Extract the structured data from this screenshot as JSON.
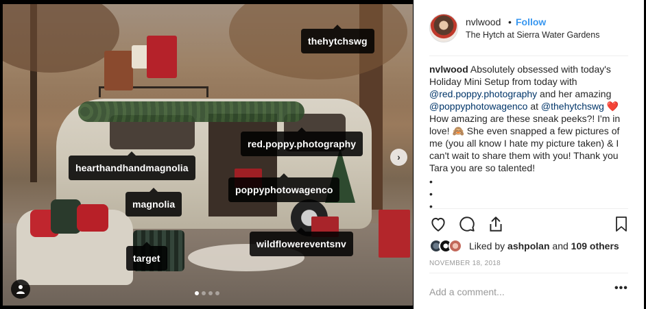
{
  "post": {
    "username": "nvlwood",
    "separator": "•",
    "follow_label": "Follow",
    "location": "The Hytch at Sierra Water Gardens",
    "caption": {
      "user": "nvlwood",
      "text_1": " Absolutely obsessed with today's Holiday Mini Setup from today with ",
      "mention_1": "@red.poppy.photography",
      "text_2": " and her amazing ",
      "mention_2": "@poppyphotowagenco",
      "text_3": " at ",
      "mention_3": "@thehytchswg",
      "heart": " ❤️",
      "text_4": " How amazing are these sneak peeks?! I'm in love! 🙈 She even snapped a few pictures of me (you all know I hate my picture taken) & I can't wait to share them with you! Thank you Tara you are so talented!"
    },
    "bullets": [
      "•",
      "•",
      "•"
    ],
    "likes": {
      "prefix": "Liked by ",
      "user": "ashpolan",
      "middle": " and ",
      "others": "109 others"
    },
    "date": "NOVEMBER 18, 2018",
    "comment_placeholder": "Add a comment...",
    "more_label": "•••"
  },
  "photo": {
    "tags": {
      "t1": "thehytchswg",
      "t2": "red.poppy.photography",
      "t3": "hearthandhandmagnolia",
      "t4": "poppyphotowagenco",
      "t5": "magnolia",
      "t6": "wildflowereventsnv",
      "t7": "target"
    },
    "next_icon": "chevron-right-icon",
    "carousel_count": 4,
    "carousel_active": 1
  },
  "colors": {
    "link": "#3897f0",
    "mention": "#003569",
    "text": "#262626",
    "muted": "#999999"
  }
}
